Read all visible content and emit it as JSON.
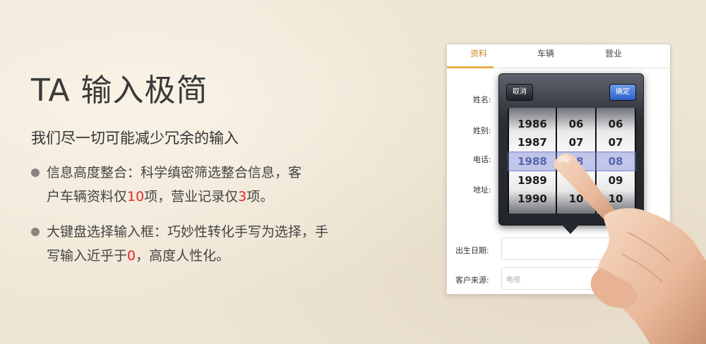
{
  "promo": {
    "headline": "TA 输入极简",
    "subtitle": "我们尽一切可能减少冗余的输入",
    "bullets": [
      {
        "line1": "信息高度整合：科学缜密筛选整合信息，客",
        "line2_pre": "户车辆资料仅",
        "line2_num": "10",
        "line2_mid": "项，营业记录仅",
        "line2_num2": "3",
        "line2_post": "项。"
      },
      {
        "line1": "大键盘选择输入框：巧妙性转化手写为选择，手",
        "line2_pre": "写输入近乎于",
        "line2_num": "0",
        "line2_post": "，高度人性化。"
      }
    ]
  },
  "app": {
    "tabs": [
      {
        "label": "资料",
        "active": true
      },
      {
        "label": "车辆",
        "active": false
      },
      {
        "label": "营业",
        "active": false
      }
    ],
    "form": {
      "name_label": "姓名:",
      "gender_label": "姓别:",
      "phone_label": "电话:",
      "address_label": "地址:",
      "birthday_label": "出生日期:",
      "source_label": "客户来源:",
      "source_value": "电视"
    },
    "picker": {
      "cancel_label": "取消",
      "ok_label": "确定",
      "years": [
        "1986",
        "1987",
        "1988",
        "1989",
        "1990"
      ],
      "months": [
        "06",
        "07",
        "08",
        "",
        "10"
      ],
      "days": [
        "06",
        "07",
        "08",
        "09",
        "10"
      ],
      "selected_index": 2
    }
  },
  "colors": {
    "accent_red": "#e4262a",
    "tab_active": "#c98c28",
    "ok_button": "#2c5fc9"
  }
}
